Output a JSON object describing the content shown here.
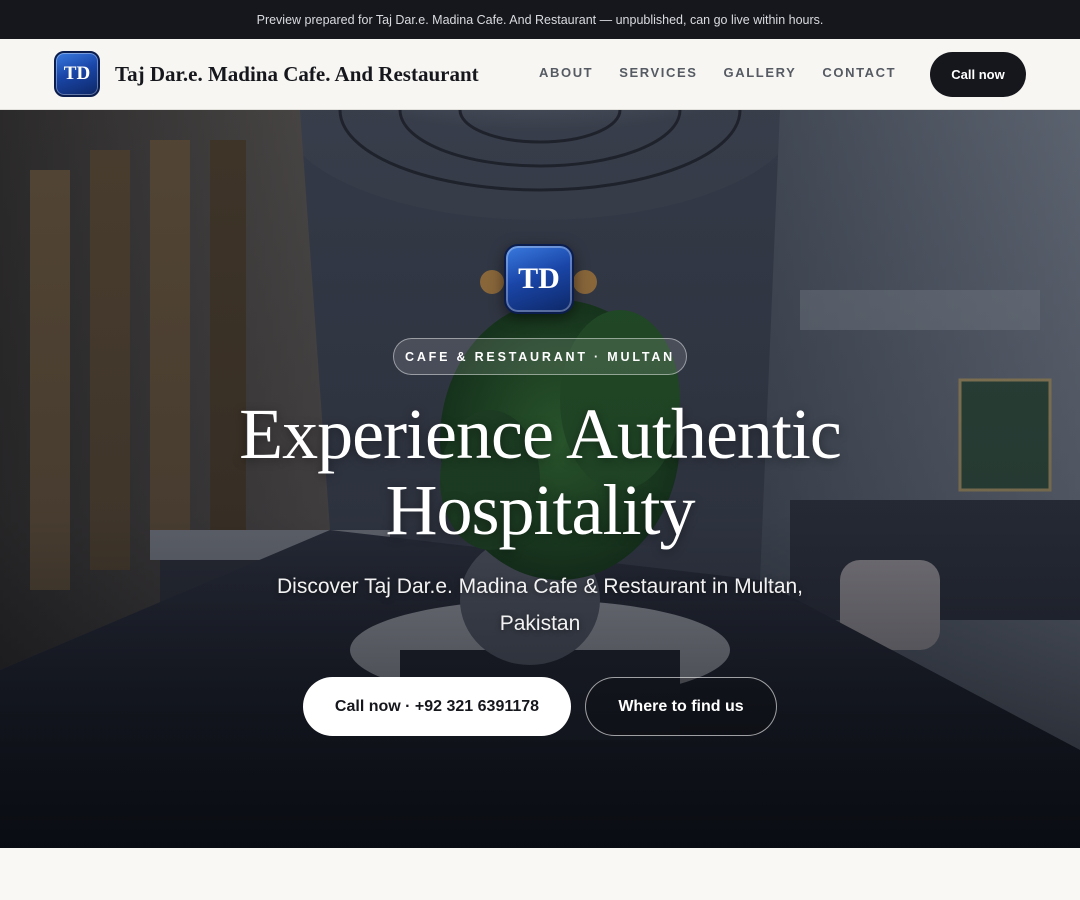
{
  "banner": {
    "text": "Preview prepared for Taj Dar.e. Madina Cafe. And Restaurant — unpublished, can go live within hours."
  },
  "header": {
    "logo_initials": "TD",
    "brand_name": "Taj Dar.e. Madina Cafe. And Restaurant",
    "nav": [
      {
        "label": "ABOUT"
      },
      {
        "label": "SERVICES"
      },
      {
        "label": "GALLERY"
      },
      {
        "label": "CONTACT"
      }
    ],
    "cta_label": "Call now"
  },
  "hero": {
    "logo_initials": "TD",
    "tagline": "CAFE & RESTAURANT · MULTAN",
    "title_line1": "Experience Authentic",
    "title_line2": "Hospitality",
    "subtitle": "Discover Taj Dar.e. Madina Cafe & Restaurant in Multan, Pakistan",
    "primary_button": "Call now · +92 321 6391178",
    "secondary_button": "Where to find us"
  },
  "colors": {
    "banner_bg": "#15171d",
    "nav_bg": "#f7f6f2",
    "cta_bg": "#15171d",
    "logo_blue": "#1a46a8"
  },
  "icons": {
    "logo": "td-monogram-badge"
  }
}
